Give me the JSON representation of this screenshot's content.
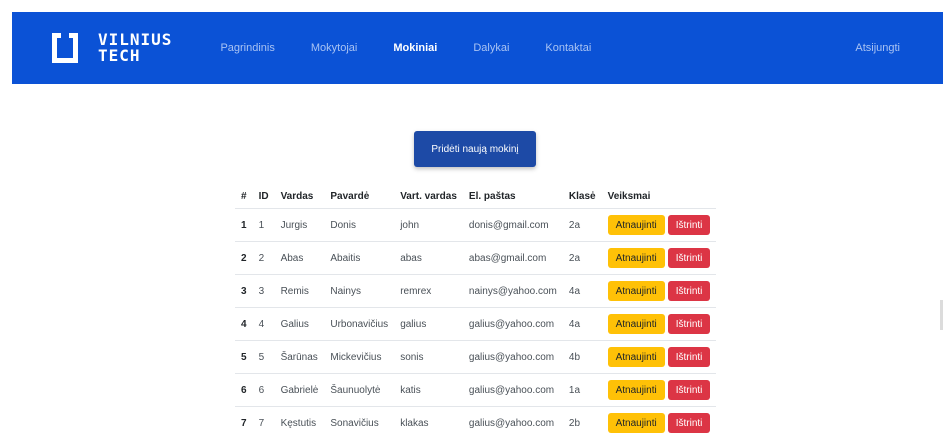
{
  "brand": {
    "line1": "VILNIUS",
    "line2": "TECH"
  },
  "nav": {
    "links": [
      {
        "label": "Pagrindinis",
        "active": false
      },
      {
        "label": "Mokytojai",
        "active": false
      },
      {
        "label": "Mokiniai",
        "active": true
      },
      {
        "label": "Dalykai",
        "active": false
      },
      {
        "label": "Kontaktai",
        "active": false
      }
    ],
    "logout": "Atsijungti"
  },
  "actions": {
    "add_label": "Pridėti naują mokinį"
  },
  "table": {
    "headers": [
      "#",
      "ID",
      "Vardas",
      "Pavardė",
      "Vart. vardas",
      "El. paštas",
      "Klasė",
      "Veiksmai"
    ],
    "rows": [
      {
        "num": "1",
        "id": "1",
        "first": "Jurgis",
        "last": "Donis",
        "user": "john",
        "email": "donis@gmail.com",
        "class": "2a"
      },
      {
        "num": "2",
        "id": "2",
        "first": "Abas",
        "last": "Abaitis",
        "user": "abas",
        "email": "abas@gmail.com",
        "class": "2a"
      },
      {
        "num": "3",
        "id": "3",
        "first": "Remis",
        "last": "Nainys",
        "user": "remrex",
        "email": "nainys@yahoo.com",
        "class": "4a"
      },
      {
        "num": "4",
        "id": "4",
        "first": "Galius",
        "last": "Urbonavičius",
        "user": "galius",
        "email": "galius@yahoo.com",
        "class": "4a"
      },
      {
        "num": "5",
        "id": "5",
        "first": "Šarūnas",
        "last": "Mickevičius",
        "user": "sonis",
        "email": "galius@yahoo.com",
        "class": "4b"
      },
      {
        "num": "6",
        "id": "6",
        "first": "Gabrielė",
        "last": "Šaunuolytė",
        "user": "katis",
        "email": "galius@yahoo.com",
        "class": "1a"
      },
      {
        "num": "7",
        "id": "7",
        "first": "Kęstutis",
        "last": "Sonavičius",
        "user": "klakas",
        "email": "galius@yahoo.com",
        "class": "2b"
      }
    ],
    "update_label": "Atnaujinti",
    "delete_label": "Ištrinti"
  },
  "colors": {
    "navbar": "#0b52d6",
    "primary_button": "#1d4aa6",
    "update": "#ffc107",
    "delete": "#dc3545"
  }
}
